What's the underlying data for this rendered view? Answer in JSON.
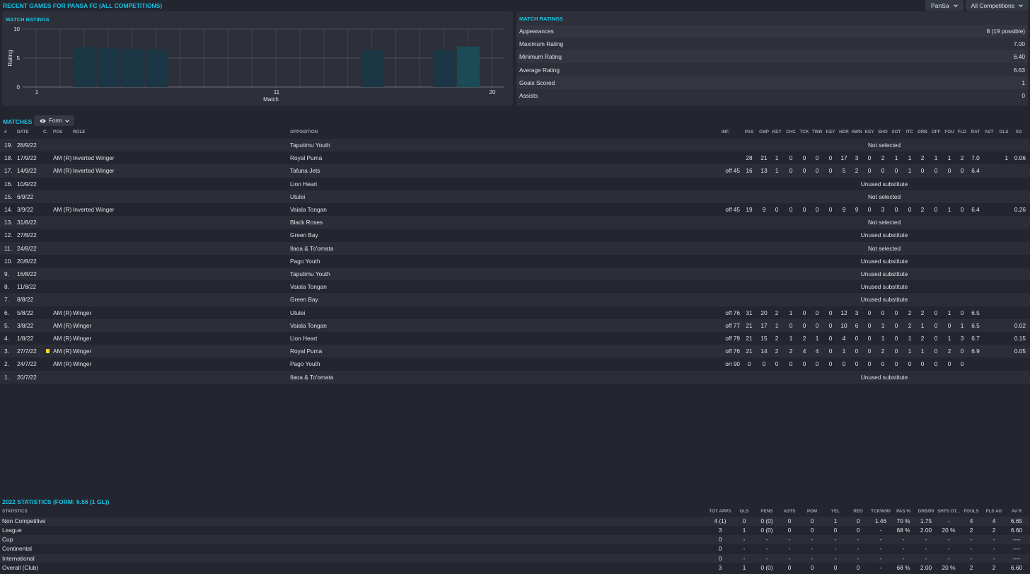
{
  "header": {
    "title": "Recent Games For PanSa FC (All Competitions)",
    "dropdown_player": "PanSa",
    "dropdown_competition": "All Competitions"
  },
  "colors": {
    "accent": "#18c4e6",
    "bar": "#1b3645",
    "bar_highlight": "#1b4b57",
    "background": "#23262f",
    "panel": "#2d3039"
  },
  "chart_data": {
    "type": "bar",
    "title": "Match Ratings",
    "xlabel": "Match",
    "ylabel": "Rating",
    "ylim": [
      0,
      10
    ],
    "xlim": [
      1,
      20
    ],
    "yticks": [
      0,
      5,
      10
    ],
    "xticks": [
      1,
      11,
      20
    ],
    "grid": true,
    "categories": [
      1,
      2,
      3,
      4,
      5,
      6,
      7,
      8,
      9,
      10,
      11,
      12,
      13,
      14,
      15,
      16,
      17,
      18,
      19,
      20
    ],
    "values": [
      null,
      null,
      6.9,
      6.7,
      6.5,
      6.5,
      null,
      null,
      null,
      null,
      null,
      null,
      null,
      null,
      6.4,
      null,
      null,
      6.4,
      7.0,
      null
    ],
    "highlight_index": 18
  },
  "ratings_panel": {
    "title": "Match Ratings",
    "rows": [
      {
        "label": "Appearances",
        "value": "8 (19 possible)"
      },
      {
        "label": "Maximum Rating",
        "value": "7.00"
      },
      {
        "label": "Minimum Rating",
        "value": "6.40"
      },
      {
        "label": "Average Rating",
        "value": "6.63"
      },
      {
        "label": "Goals Scored",
        "value": "1"
      },
      {
        "label": "Assists",
        "value": "0"
      }
    ]
  },
  "matches": {
    "title": "Matches",
    "view_button": "Form",
    "columns": [
      "#",
      "DATE",
      "C.",
      "POS",
      "ROLE",
      "OPPOSITION",
      "INF.",
      "PAS",
      "CMP",
      "KEY",
      "CHC",
      "TCK",
      "TWN",
      "KEY",
      "HDR",
      "HWN",
      "KEY",
      "SHO",
      "SOT",
      "ITC",
      "DRB",
      "OFF",
      "FOU",
      "FLD",
      "RAT",
      "AST",
      "GLS",
      "XG"
    ],
    "rows": [
      {
        "num": "19.",
        "date": "28/9/22",
        "card": false,
        "pos": "",
        "role": "",
        "opp": "Taputimu Youth",
        "note": "Not selected"
      },
      {
        "num": "18.",
        "date": "17/9/22",
        "card": false,
        "pos": "AM (R)",
        "role": "Inverted Winger",
        "opp": "Royal Puma",
        "inf": "",
        "stats": [
          "28",
          "21",
          "1",
          "0",
          "0",
          "0",
          "0",
          "17",
          "3",
          "0",
          "2",
          "1",
          "1",
          "2",
          "1",
          "1",
          "2",
          "7.0"
        ],
        "ast": "",
        "gls": "1",
        "xg": "0.06"
      },
      {
        "num": "17.",
        "date": "14/9/22",
        "card": false,
        "pos": "AM (R)",
        "role": "Inverted Winger",
        "opp": "Tafuna Jets",
        "inf": "off 45",
        "stats": [
          "16",
          "13",
          "1",
          "0",
          "0",
          "0",
          "0",
          "5",
          "2",
          "0",
          "0",
          "0",
          "1",
          "0",
          "0",
          "0",
          "0",
          "6.4"
        ],
        "ast": "",
        "gls": "",
        "xg": ""
      },
      {
        "num": "16.",
        "date": "10/9/22",
        "card": false,
        "pos": "",
        "role": "",
        "opp": "Lion Heart",
        "note": "Unused substitute"
      },
      {
        "num": "15.",
        "date": "6/9/22",
        "card": false,
        "pos": "",
        "role": "",
        "opp": "Utulei",
        "note": "Not selected"
      },
      {
        "num": "14.",
        "date": "3/9/22",
        "card": false,
        "pos": "AM (R)",
        "role": "Inverted Winger",
        "opp": "Vaiala Tongan",
        "inf": "off 45",
        "stats": [
          "19",
          "9",
          "0",
          "0",
          "0",
          "0",
          "0",
          "9",
          "9",
          "0",
          "3",
          "0",
          "0",
          "2",
          "0",
          "1",
          "0",
          "6.4"
        ],
        "ast": "",
        "gls": "",
        "xg": "0.26"
      },
      {
        "num": "13.",
        "date": "31/8/22",
        "card": false,
        "pos": "",
        "role": "",
        "opp": "Black Roses",
        "note": "Not selected"
      },
      {
        "num": "12.",
        "date": "27/8/22",
        "card": false,
        "pos": "",
        "role": "",
        "opp": "Green Bay",
        "note": "Unused substitute"
      },
      {
        "num": "11.",
        "date": "24/8/22",
        "card": false,
        "pos": "",
        "role": "",
        "opp": "Ilaoa & To'omata",
        "note": "Not selected"
      },
      {
        "num": "10.",
        "date": "20/8/22",
        "card": false,
        "pos": "",
        "role": "",
        "opp": "Pago Youth",
        "note": "Unused substitute"
      },
      {
        "num": "9.",
        "date": "16/8/22",
        "card": false,
        "pos": "",
        "role": "",
        "opp": "Taputimu Youth",
        "note": "Unused substitute"
      },
      {
        "num": "8.",
        "date": "11/8/22",
        "card": false,
        "pos": "",
        "role": "",
        "opp": "Vaiala Tongan",
        "note": "Unused substitute"
      },
      {
        "num": "7.",
        "date": "8/8/22",
        "card": false,
        "pos": "",
        "role": "",
        "opp": "Green Bay",
        "note": "Unused substitute"
      },
      {
        "num": "6.",
        "date": "5/8/22",
        "card": false,
        "pos": "AM (R)",
        "role": "Winger",
        "opp": "Utulei",
        "inf": "off 76",
        "stats": [
          "31",
          "20",
          "2",
          "1",
          "0",
          "0",
          "0",
          "12",
          "3",
          "0",
          "0",
          "0",
          "2",
          "2",
          "0",
          "1",
          "0",
          "6.5"
        ],
        "ast": "",
        "gls": "",
        "xg": ""
      },
      {
        "num": "5.",
        "date": "3/8/22",
        "card": false,
        "pos": "AM (R)",
        "role": "Winger",
        "opp": "Vaiala Tongan",
        "inf": "off 77",
        "stats": [
          "21",
          "17",
          "1",
          "0",
          "0",
          "0",
          "0",
          "10",
          "6",
          "0",
          "1",
          "0",
          "2",
          "1",
          "0",
          "0",
          "1",
          "6.5"
        ],
        "ast": "",
        "gls": "",
        "xg": "0.02"
      },
      {
        "num": "4.",
        "date": "1/8/22",
        "card": false,
        "pos": "AM (R)",
        "role": "Winger",
        "opp": "Lion Heart",
        "inf": "off 79",
        "stats": [
          "21",
          "15",
          "2",
          "1",
          "2",
          "1",
          "0",
          "4",
          "0",
          "0",
          "1",
          "0",
          "1",
          "2",
          "0",
          "1",
          "3",
          "6.7"
        ],
        "ast": "",
        "gls": "",
        "xg": "0.15"
      },
      {
        "num": "3.",
        "date": "27/7/22",
        "card": true,
        "pos": "AM (R)",
        "role": "Winger",
        "opp": "Royal Puma",
        "inf": "off 76",
        "stats": [
          "21",
          "14",
          "2",
          "2",
          "4",
          "4",
          "0",
          "1",
          "0",
          "0",
          "2",
          "0",
          "1",
          "1",
          "0",
          "2",
          "0",
          "6.9"
        ],
        "ast": "",
        "gls": "",
        "xg": "0.05"
      },
      {
        "num": "2.",
        "date": "24/7/22",
        "card": false,
        "pos": "AM (R)",
        "role": "Winger",
        "opp": "Pago Youth",
        "inf": "on 90",
        "stats": [
          "0",
          "0",
          "0",
          "0",
          "0",
          "0",
          "0",
          "0",
          "0",
          "0",
          "0",
          "0",
          "0",
          "0",
          "0",
          "0",
          "0",
          ""
        ],
        "ast": "",
        "gls": "",
        "xg": ""
      },
      {
        "num": "1.",
        "date": "20/7/22",
        "card": false,
        "pos": "",
        "role": "",
        "opp": "Ilaoa & To'omata",
        "note": "Unused substitute"
      }
    ]
  },
  "season": {
    "title": "2022 Statistics (Form: 6.56 (1 GL))",
    "label_header": "STATISTICS",
    "columns": [
      "TOT APPS",
      "GLS",
      "PENS",
      "ASTS",
      "POM",
      "YEL",
      "RED",
      "TCKW/90",
      "PAS %",
      "DRB/90",
      "SHTS OT...",
      "FOULS",
      "FLS AG",
      "AV R"
    ],
    "rows": [
      {
        "label": "Non Competitive",
        "values": [
          "4 (1)",
          "0",
          "0 (0)",
          "0",
          "0",
          "1",
          "0",
          "1.46",
          "70 %",
          "1.75",
          "-",
          "4",
          "4",
          "6.65"
        ]
      },
      {
        "label": "League",
        "values": [
          "3",
          "1",
          "0 (0)",
          "0",
          "0",
          "0",
          "0",
          "-",
          "68 %",
          "2.00",
          "20 %",
          "2",
          "2",
          "6.60"
        ]
      },
      {
        "label": "Cup",
        "values": [
          "0",
          "-",
          "-",
          "-",
          "-",
          "-",
          "-",
          "-",
          "-",
          "-",
          "-",
          "-",
          "-",
          "----"
        ]
      },
      {
        "label": "Continental",
        "values": [
          "0",
          "-",
          "-",
          "-",
          "-",
          "-",
          "-",
          "-",
          "-",
          "-",
          "-",
          "-",
          "-",
          "----"
        ]
      },
      {
        "label": "International",
        "values": [
          "0",
          "-",
          "-",
          "-",
          "-",
          "-",
          "-",
          "-",
          "-",
          "-",
          "-",
          "-",
          "-",
          "----"
        ]
      },
      {
        "label": "Overall (Club)",
        "values": [
          "3",
          "1",
          "0 (0)",
          "0",
          "0",
          "0",
          "0",
          "-",
          "68 %",
          "2.00",
          "20 %",
          "2",
          "2",
          "6.60"
        ]
      }
    ]
  }
}
